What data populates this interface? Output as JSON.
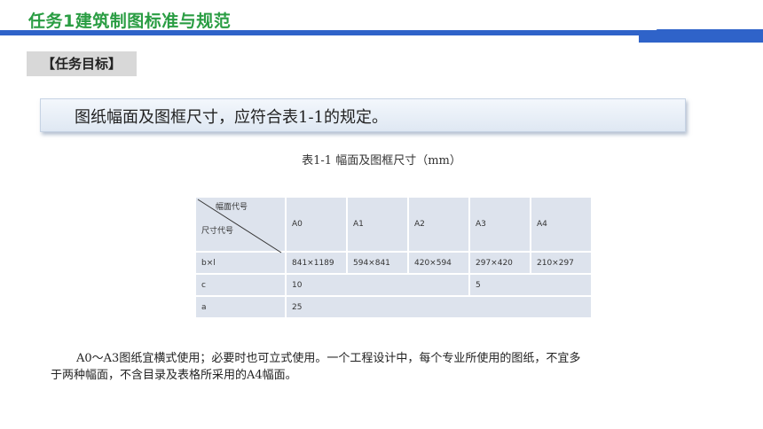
{
  "header": {
    "title": "任务1建筑制图标准与规范"
  },
  "section_tag": "【任务目标】",
  "banner": {
    "text": "图纸幅面及图框尺寸，应符合表1-1的规定。"
  },
  "table": {
    "caption": "表1-1  幅面及图框尺寸（mm）",
    "corner_top": "幅面代号",
    "corner_bottom": "尺寸代号",
    "columns": [
      "A0",
      "A1",
      "A2",
      "A3",
      "A4"
    ],
    "rows": [
      {
        "label": "b×l",
        "cells": [
          "841×1189",
          "594×841",
          "420×594",
          "297×420",
          "210×297"
        ]
      },
      {
        "label": "c",
        "cells": [
          "10",
          "5"
        ]
      },
      {
        "label": "a",
        "cells": [
          "25"
        ]
      }
    ]
  },
  "paragraph": {
    "line1": "A0～A3图纸宜横式使用；必要时也可立式使用。一个工程设计中，每个专业所使用的图纸，不宜多",
    "line2": "于两种幅面，不含目录及表格所采用的A4幅面。"
  },
  "colors": {
    "title_green": "#2a9d43",
    "accent_blue": "#2f63c9",
    "table_fill": "#dde3ed"
  }
}
